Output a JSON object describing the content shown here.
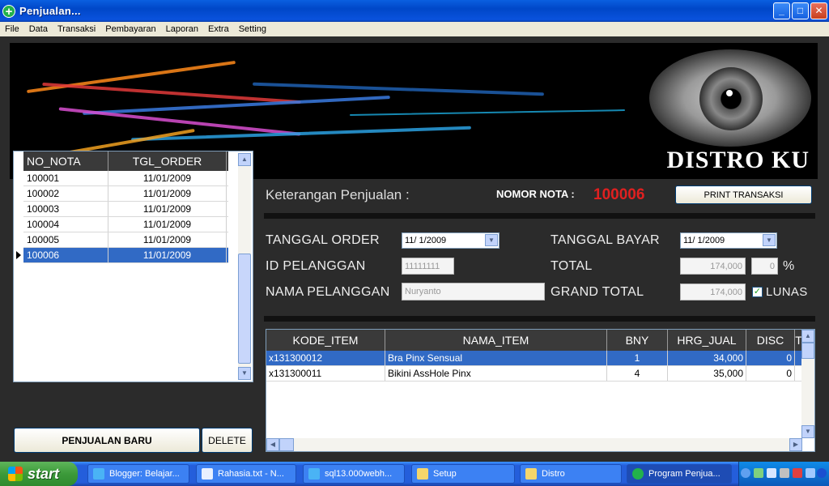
{
  "window": {
    "title": "Penjualan...",
    "min_label": "_",
    "max_label": "□",
    "close_label": "✕"
  },
  "menu": [
    "File",
    "Data",
    "Transaksi",
    "Pembayaran",
    "Laporan",
    "Extra",
    "Setting"
  ],
  "banner": {
    "brand": "DISTRO KU"
  },
  "orders": {
    "headers": [
      "NO_NOTA",
      "TGL_ORDER"
    ],
    "rows": [
      [
        "100001",
        "11/01/2009"
      ],
      [
        "100002",
        "11/01/2009"
      ],
      [
        "100003",
        "11/01/2009"
      ],
      [
        "100004",
        "11/01/2009"
      ],
      [
        "100005",
        "11/01/2009"
      ],
      [
        "100006",
        "11/01/2009"
      ]
    ],
    "selected_index": 5
  },
  "buttons": {
    "new_sale": "PENJUALAN BARU",
    "delete": "DELETE",
    "print": "PRINT TRANSAKSI"
  },
  "header": {
    "keterangan_label": "Keterangan Penjualan :",
    "nomor_nota_label": "NOMOR NOTA :",
    "nomor_nota_value": "100006"
  },
  "form": {
    "tanggal_order_label": "TANGGAL ORDER",
    "tanggal_order_value": "11/ 1/2009",
    "id_pelanggan_label": "ID PELANGGAN",
    "id_pelanggan_value": "11111111",
    "nama_pelanggan_label": "NAMA PELANGGAN",
    "nama_pelanggan_value": "Nuryanto",
    "tanggal_bayar_label": "TANGGAL BAYAR",
    "tanggal_bayar_value": "11/ 1/2009",
    "total_label": "TOTAL",
    "total_value": "174,000",
    "percent_value": "0",
    "percent_sign": "%",
    "grand_total_label": "GRAND TOTAL",
    "grand_total_value": "174,000",
    "lunas_label": "LUNAS",
    "lunas_checked": true
  },
  "items": {
    "headers": [
      "KODE_ITEM",
      "NAMA_ITEM",
      "BNY",
      "HRG_JUAL",
      "DISC",
      "T"
    ],
    "rows": [
      [
        "x131300012",
        "Bra Pinx Sensual",
        "1",
        "34,000",
        "0"
      ],
      [
        "x131300011",
        "Bikini AssHole Pinx",
        "4",
        "35,000",
        "0"
      ]
    ],
    "selected_index": 0
  },
  "taskbar": {
    "start": "start",
    "tasks": [
      "Blogger: Belajar...",
      "Rahasia.txt - N...",
      "sql13.000webh...",
      "Setup",
      "Distro",
      "Program Penjua..."
    ]
  },
  "colors": {
    "selection": "#316ac5",
    "nota_red": "#e02020",
    "header_dark": "#3a3a3a",
    "xp_blue": "#245edb"
  }
}
